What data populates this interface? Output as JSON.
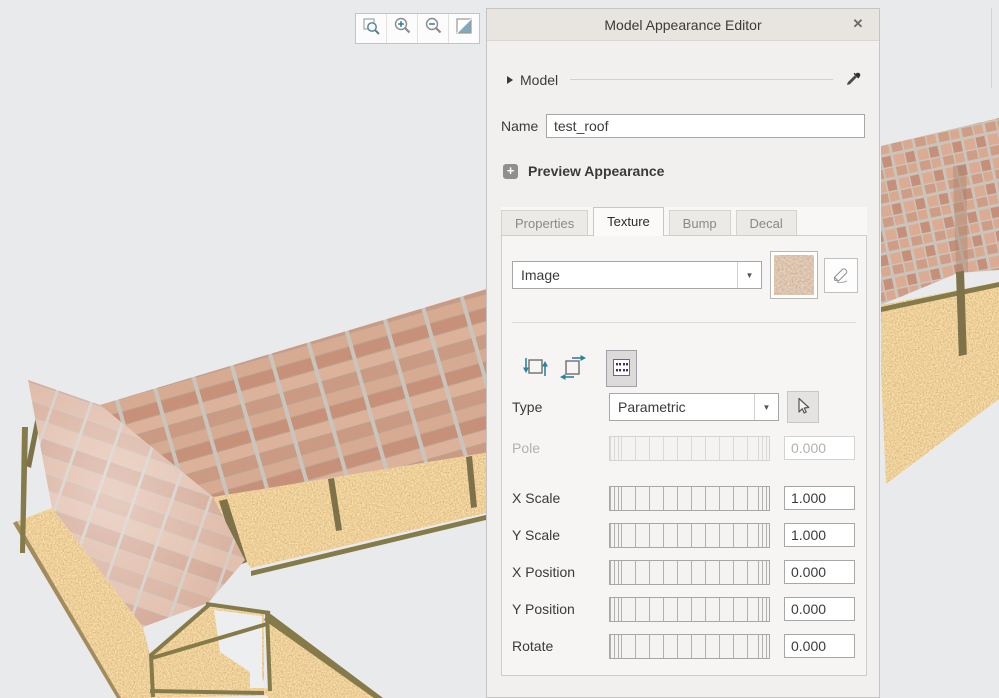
{
  "viewer": {
    "toolbar": {
      "icons": [
        "zoom-region",
        "zoom-in",
        "zoom-out",
        "refit"
      ]
    },
    "scene": {
      "objects": "gabled canopy structures with brick-tile roof and OSB panels"
    }
  },
  "panel": {
    "title": "Model Appearance Editor",
    "close_label": "✕",
    "model_section": {
      "label": "Model"
    },
    "name_field": {
      "label": "Name",
      "value": "test_roof"
    },
    "preview_appearance": {
      "label": "Preview Appearance"
    },
    "tabs": [
      {
        "label": "Properties",
        "active": false
      },
      {
        "label": "Texture",
        "active": true
      },
      {
        "label": "Bump",
        "active": false
      },
      {
        "label": "Decal",
        "active": false
      }
    ],
    "texture_tab": {
      "map_dropdown": {
        "value": "Image"
      },
      "placement_icons": [
        "repeat-vertical-icon",
        "repeat-horizontal-icon",
        "parametric-placement-icon"
      ],
      "type_row": {
        "label": "Type",
        "value": "Parametric"
      },
      "sliders": [
        {
          "label": "Pole",
          "value": "0.000",
          "disabled": true
        },
        {
          "label": "X Scale",
          "value": "1.000",
          "disabled": false
        },
        {
          "label": "Y Scale",
          "value": "1.000",
          "disabled": false
        },
        {
          "label": "X Position",
          "value": "0.000",
          "disabled": false
        },
        {
          "label": "Y Position",
          "value": "0.000",
          "disabled": false
        },
        {
          "label": "Rotate",
          "value": "0.000",
          "disabled": false
        }
      ]
    }
  },
  "colors": {
    "accent_teal": "#2e82a0",
    "roof_brick": "#cf9c85",
    "roof_washed": "#ddb6a4",
    "osb_tan": "#c9a173",
    "frame_olive": "#857a4a",
    "panel_bg": "#f1f0ee",
    "titlebar_bg": "#e8e5e1",
    "viewport_bg": "#e9eaeb"
  }
}
